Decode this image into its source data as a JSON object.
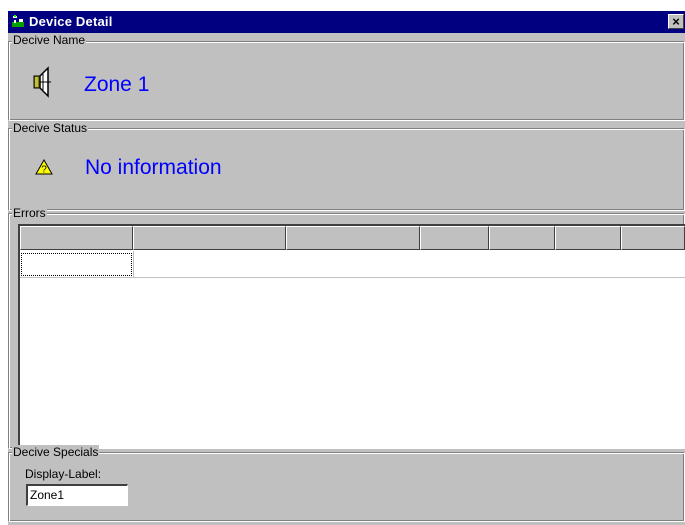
{
  "window": {
    "title": "Device Detail",
    "close_label": "×"
  },
  "device_name": {
    "label": "Decive Name",
    "value": "Zone 1",
    "icon": "speaker-icon"
  },
  "device_status": {
    "label": "Decive Status",
    "value": "No information",
    "icon": "warning-icon",
    "color": "#0000ff"
  },
  "errors": {
    "label": "Errors",
    "columns": [
      "",
      "",
      "",
      "",
      "",
      "",
      ""
    ],
    "rows": [
      [
        "",
        "",
        "",
        "",
        "",
        "",
        ""
      ]
    ]
  },
  "device_specials": {
    "label": "Decive Specials",
    "display_label_caption": "Display-Label:",
    "display_label_value": "Zone1"
  }
}
